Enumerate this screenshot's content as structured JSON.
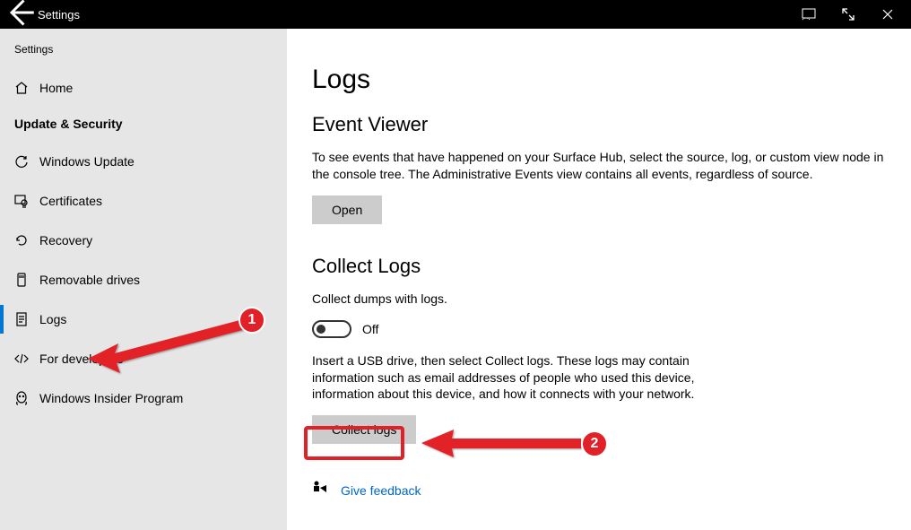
{
  "titlebar": {
    "title": "Settings"
  },
  "sidebar": {
    "crumb": "Settings",
    "home": "Home",
    "section": "Update & Security",
    "items": [
      {
        "label": "Windows Update"
      },
      {
        "label": "Certificates"
      },
      {
        "label": "Recovery"
      },
      {
        "label": "Removable drives"
      },
      {
        "label": "Logs"
      },
      {
        "label": "For developers"
      },
      {
        "label": "Windows Insider Program"
      }
    ]
  },
  "main": {
    "title": "Logs",
    "event_viewer": {
      "heading": "Event Viewer",
      "desc": "To see events that have happened on your Surface Hub, select the source, log, or custom view node in the console tree. The Administrative Events view contains all events, regardless of source.",
      "open_btn": "Open"
    },
    "collect": {
      "heading": "Collect Logs",
      "dumps_label": "Collect dumps with logs.",
      "toggle_state": "Off",
      "desc": "Insert a USB drive, then select Collect logs. These logs may contain information such as email addresses of people who used this device, information about this device, and how it connects with your network.",
      "collect_btn": "Collect logs"
    },
    "feedback": "Give feedback"
  },
  "annotations": {
    "num1": "1",
    "num2": "2"
  }
}
